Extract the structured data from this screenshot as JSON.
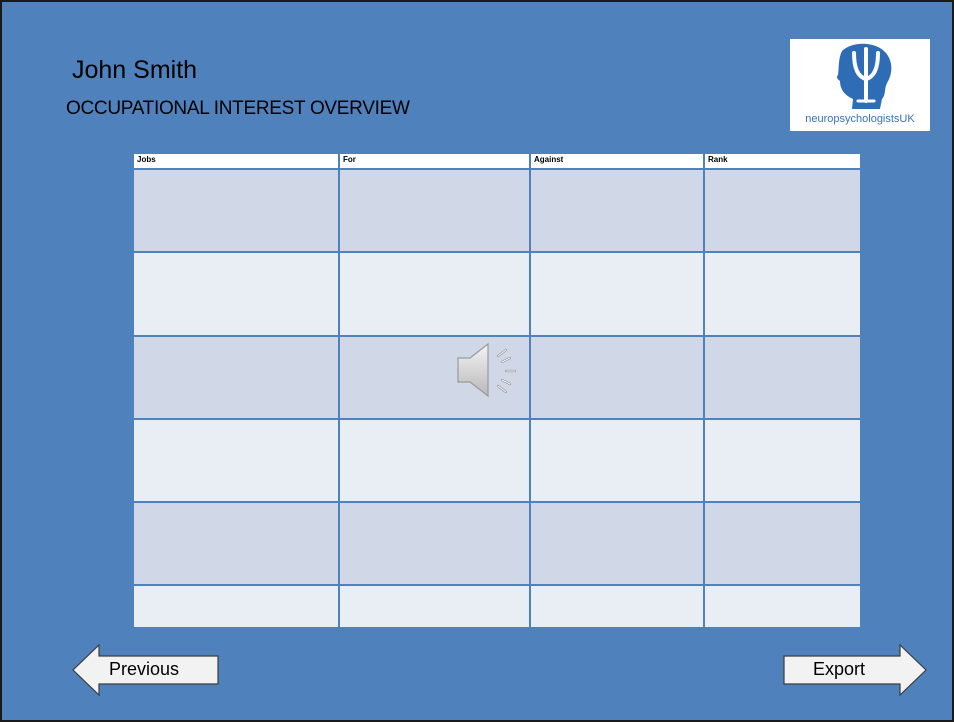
{
  "slide": {
    "person_name": "John Smith",
    "subtitle": "OCCUPATIONAL INTEREST OVERVIEW"
  },
  "logo": {
    "icon": "psi-head-icon",
    "text": "neuropsychologistsUK",
    "color": "#3a73b7"
  },
  "table": {
    "headers": [
      "Jobs",
      "For",
      "Against",
      "Rank"
    ],
    "rows": [
      [
        "",
        "",
        "",
        ""
      ],
      [
        "",
        "",
        "",
        ""
      ],
      [
        "",
        "",
        "",
        ""
      ],
      [
        "",
        "",
        "",
        ""
      ],
      [
        "",
        "",
        "",
        ""
      ],
      [
        "",
        "",
        "",
        ""
      ]
    ]
  },
  "media": {
    "icon": "speaker-icon"
  },
  "navigation": {
    "previous_label": "Previous",
    "export_label": "Export"
  },
  "colors": {
    "background": "#4f81bd",
    "row_dark": "#d0d8e8",
    "row_light": "#e9edf4"
  }
}
